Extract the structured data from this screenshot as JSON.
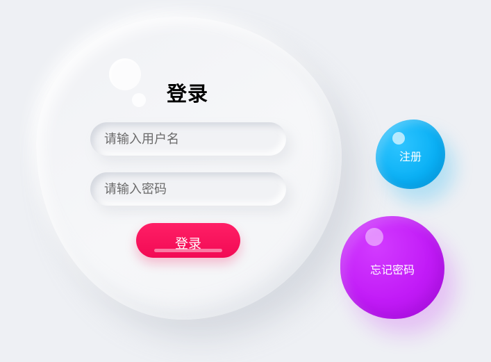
{
  "login_form": {
    "title": "登录",
    "username_placeholder": "请输入用户名",
    "username_value": "",
    "password_placeholder": "请输入密码",
    "password_value": "",
    "login_button": "登录"
  },
  "side_actions": {
    "register_button": "注册",
    "forgot_password_button": "忘记密码"
  },
  "colors": {
    "background": "#eef0f4",
    "login_button": "#f20a54",
    "register_button": "#09b0f5",
    "forgot_password_button": "#c21bf7"
  }
}
